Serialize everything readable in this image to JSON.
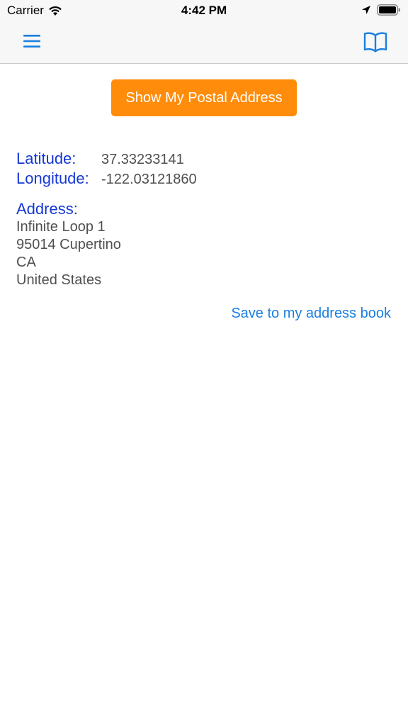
{
  "status_bar": {
    "carrier": "Carrier",
    "time": "4:42 PM",
    "icons": [
      "wifi-icon",
      "location-arrow-icon",
      "battery-icon"
    ]
  },
  "nav_bar": {
    "left_icon": "hamburger-menu-icon",
    "right_icon": "book-icon",
    "accent_color": "#1a7fe0"
  },
  "main": {
    "show_address_button": "Show My Postal Address",
    "button_color": "#ff8c0b",
    "latitude_label": "Latitude:",
    "latitude_value": "37.33233141",
    "longitude_label": "Longitude:",
    "longitude_value": "-122.03121860",
    "address_label": "Address:",
    "address_lines": [
      "Infinite Loop 1",
      "95014 Cupertino",
      "CA",
      "United States"
    ],
    "save_link": "Save to my address book"
  }
}
